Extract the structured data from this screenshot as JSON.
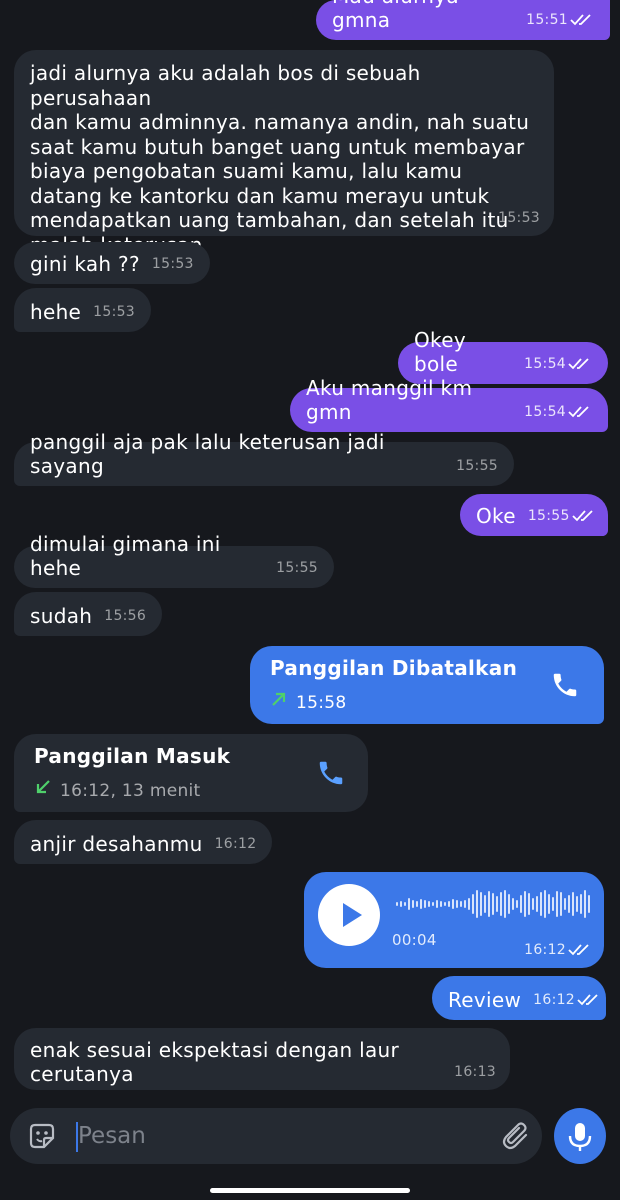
{
  "messages": {
    "m1": {
      "text": "Mau alurnya gmna",
      "time": "15:51"
    },
    "m2": {
      "text": "jadi alurnya aku adalah bos di sebuah perusahaan\ndan kamu adminnya. namanya andin, nah suatu\nsaat kamu butuh banget uang untuk membayar\nbiaya pengobatan suami kamu, lalu kamu\ndatang ke kantorku dan kamu merayu untuk\nmendapatkan uang tambahan, dan setelah itu\nmalah keterusan",
      "time": "15:53"
    },
    "m3": {
      "text": "gini kah ??",
      "time": "15:53"
    },
    "m4": {
      "text": "hehe",
      "time": "15:53"
    },
    "m5": {
      "text": "Okey bole",
      "time": "15:54"
    },
    "m6": {
      "text": "Aku manggil km gmn",
      "time": "15:54"
    },
    "m7": {
      "text": "panggil aja pak lalu keterusan jadi sayang",
      "time": "15:55"
    },
    "m8": {
      "text": "Oke",
      "time": "15:55"
    },
    "m9": {
      "text": "dimulai gimana ini hehe",
      "time": "15:55"
    },
    "m10": {
      "text": "sudah",
      "time": "15:56"
    },
    "m11": {
      "title": "Panggilan Dibatalkan",
      "time": "15:58"
    },
    "m12": {
      "title": "Panggilan Masuk",
      "time": "16:12, 13 menit"
    },
    "m13": {
      "text": "anjir desahanmu",
      "time": "16:12"
    },
    "m14": {
      "duration": "00:04",
      "time": "16:12"
    },
    "m15": {
      "text": "Review",
      "time": "16:12"
    },
    "m16": {
      "text": "enak sesuai ekspektasi dengan laur cerutanya",
      "time": "16:13"
    }
  },
  "composer": {
    "placeholder": "Pesan"
  },
  "colors": {
    "background": "#16181d",
    "incoming_bubble": "#252a32",
    "outgoing_purple": "#7a4fe6",
    "outgoing_blue": "#3c78e8",
    "call_arrow": "#4fd06b",
    "phone_icon": "#5aa0ff"
  },
  "icons": [
    "read-checkmarks-icon",
    "phone-icon",
    "outgoing-arrow-icon",
    "incoming-arrow-icon",
    "play-icon",
    "sticker-icon",
    "paperclip-icon",
    "microphone-icon"
  ]
}
